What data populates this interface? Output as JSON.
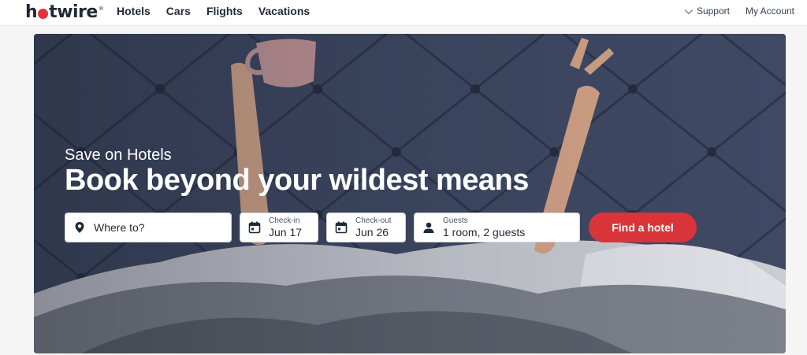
{
  "header": {
    "logo_prefix": "h",
    "logo_suffix": "twire",
    "logo_mark": "®",
    "nav": [
      "Hotels",
      "Cars",
      "Flights",
      "Vacations"
    ],
    "support": "Support",
    "account": "My Account"
  },
  "hero": {
    "eyebrow": "Save on Hotels",
    "headline": "Book beyond your wildest means"
  },
  "search": {
    "destination_placeholder": "Where to?",
    "checkin_label": "Check-in",
    "checkin_value": "Jun 17",
    "checkout_label": "Check-out",
    "checkout_value": "Jun 26",
    "guests_label": "Guests",
    "guests_value": "1 room, 2 guests",
    "find_label": "Find a hotel"
  },
  "colors": {
    "brand_red": "#d9343a",
    "text_dark": "#1f2937"
  },
  "icons": [
    "location-pin-icon",
    "calendar-icon",
    "person-icon",
    "chevron-down-icon"
  ]
}
